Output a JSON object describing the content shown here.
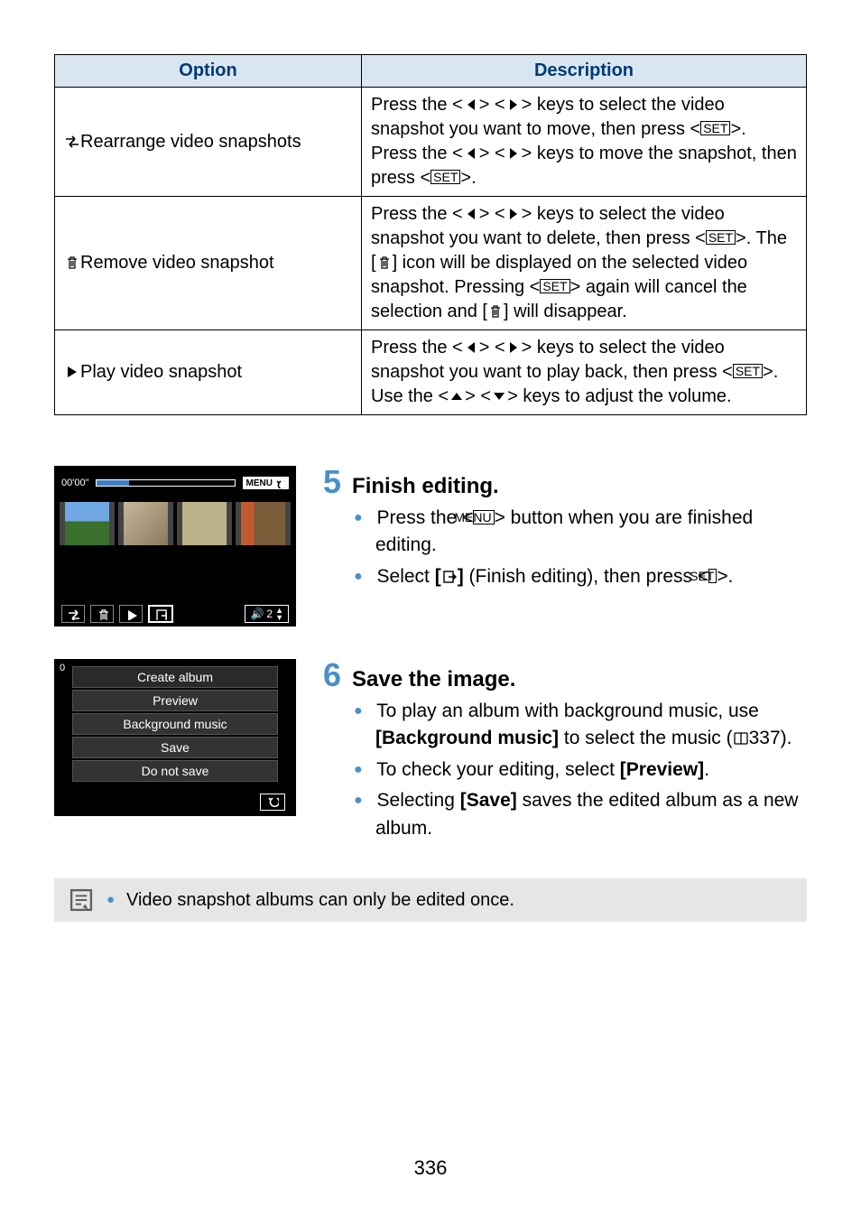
{
  "table": {
    "head_option": "Option",
    "head_desc": "Description",
    "rows": [
      {
        "option": "Rearrange video snapshots",
        "desc_text_parts": {
          "a": "Press the <",
          "b": "> <",
          "c": "> keys to select the video snapshot you want to move, then press <",
          "d": ">. Press the <",
          "e": "> <",
          "f": "> keys to move the snapshot, then press <",
          "g": ">."
        }
      },
      {
        "option": "Remove video snapshot",
        "desc_text_parts": {
          "a": "Press the <",
          "b": "> <",
          "c": "> keys to select the video snapshot you want to delete, then press <",
          "d": ">. The [",
          "e": "] icon will be displayed on the selected video snapshot. Pressing <",
          "f": "> again will cancel the selection and [",
          "g": "] will disappear."
        }
      },
      {
        "option": "Play video snapshot",
        "desc_text_parts": {
          "a": "Press the <",
          "b": "> <",
          "c": "> keys to select the video snapshot you want to play back, then press <",
          "d": ">. Use the <",
          "e": "> <",
          "f": "> keys to adjust the volume."
        }
      }
    ]
  },
  "key_labels": {
    "set": "SET",
    "menu": "MENU"
  },
  "steps": {
    "s5": {
      "num": "5",
      "title": "Finish editing.",
      "b1_a": "Press the <",
      "b1_b": "> button when you are finished editing.",
      "b2_a": "Select ",
      "b2_b": "[",
      "b2_c": "]",
      "b2_d": " (Finish editing), then press <",
      "b2_e": ">."
    },
    "s6": {
      "num": "6",
      "title": "Save the image.",
      "b1_a": "To play an album with background music, use ",
      "b1_bold": "[Background music]",
      "b1_b": " to select the music (",
      "b1_ref": "337",
      "b1_c": ").",
      "b2_a": "To check your editing, select ",
      "b2_bold": "[Preview]",
      "b2_b": ".",
      "b3_a": "Selecting ",
      "b3_bold": "[Save]",
      "b3_b": " saves the edited album as a new album."
    }
  },
  "shot1": {
    "timer": "00'00\"",
    "menu": "MENU",
    "vol_num": "2"
  },
  "shot2": {
    "corner": "0",
    "items": [
      "Create album",
      "Preview",
      "Background music",
      "Save",
      "Do not save"
    ]
  },
  "note": {
    "text": "Video snapshot albums can only be edited once."
  },
  "page": "336"
}
